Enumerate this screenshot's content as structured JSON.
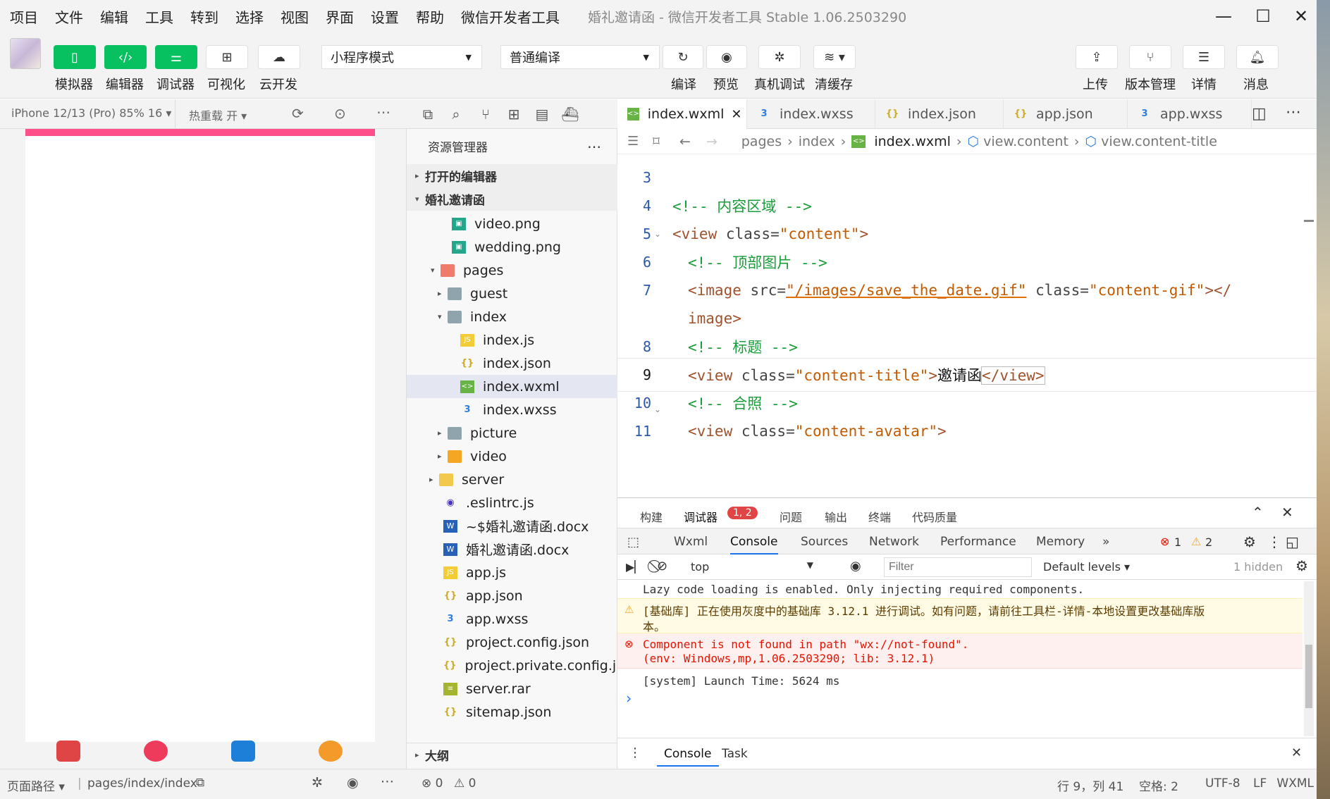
{
  "menu": [
    "项目",
    "文件",
    "编辑",
    "工具",
    "转到",
    "选择",
    "视图",
    "界面",
    "设置",
    "帮助",
    "微信开发者工具"
  ],
  "window_title": "婚礼邀请函 - 微信开发者工具 Stable 1.06.2503290",
  "toolbar": {
    "simulator": "模拟器",
    "editor": "编辑器",
    "debugger": "调试器",
    "visual": "可视化",
    "cloud": "云开发",
    "mode": "小程序模式",
    "compile_mode": "普通编译",
    "compile": "编译",
    "preview": "预览",
    "real_debug": "真机调试",
    "clear_cache": "清缓存",
    "upload": "上传",
    "version": "版本管理",
    "details": "详情",
    "message": "消息"
  },
  "sim": {
    "device": "iPhone 12/13 (Pro) 85% 16 ▾",
    "hot_reload": "热重载 开 ▾"
  },
  "explorer": {
    "title": "资源管理器",
    "open_editors": "打开的编辑器",
    "project": "婚礼邀请函",
    "outline": "大纲",
    "files": [
      {
        "name": "video.png"
      },
      {
        "name": "wedding.png"
      },
      {
        "name": "pages"
      },
      {
        "name": "guest"
      },
      {
        "name": "index"
      },
      {
        "name": "index.js"
      },
      {
        "name": "index.json"
      },
      {
        "name": "index.wxml"
      },
      {
        "name": "index.wxss"
      },
      {
        "name": "picture"
      },
      {
        "name": "video"
      },
      {
        "name": "server"
      },
      {
        "name": ".eslintrc.js"
      },
      {
        "name": "~$婚礼邀请函.docx"
      },
      {
        "name": "婚礼邀请函.docx"
      },
      {
        "name": "app.js"
      },
      {
        "name": "app.json"
      },
      {
        "name": "app.wxss"
      },
      {
        "name": "project.config.json"
      },
      {
        "name": "project.private.config.j..."
      },
      {
        "name": "server.rar"
      },
      {
        "name": "sitemap.json"
      }
    ]
  },
  "tabs": [
    "index.wxml",
    "index.wxss",
    "index.json",
    "app.json",
    "app.wxss"
  ],
  "breadcrumb": [
    "pages",
    "index",
    "index.wxml",
    "view.content",
    "view.content-title"
  ],
  "code": {
    "l3": "3",
    "l4": "4",
    "l5": "5",
    "l6": "6",
    "l7": "7",
    "l8": "8",
    "l9": "9",
    "l10": "10",
    "l11": "11",
    "c4": "<!-- 内容区域 -->",
    "c6": "<!-- 顶部图片 -->",
    "c8": "<!-- 标题 -->",
    "c10": "<!-- 合照 -->",
    "tag_view_open": "<view",
    "tag_image_open": "<image",
    "attr_class": " class=",
    "attr_src": " src=",
    "s_content": "\"content\"",
    "s_gif": "\"/images/save_the_date.gif\"",
    "s_content_gif": "\"content-gif\"",
    "s_content_title": "\"content-title\"",
    "s_content_avatar": "\"content-avatar\"",
    "gt": ">",
    "image_close1": "></",
    "image_close2": "image>",
    "title_text": "邀请函",
    "view_close": "</view>"
  },
  "debug": {
    "tabs": [
      "构建",
      "调试器",
      "问题",
      "输出",
      "终端",
      "代码质量"
    ],
    "badge": "1, 2",
    "devtools": [
      "Wxml",
      "Console",
      "Sources",
      "Network",
      "Performance",
      "Memory",
      "»"
    ],
    "err_count": "1",
    "warn_count": "2",
    "context": "top",
    "filter_placeholder": "Filter",
    "levels": "Default levels ▾",
    "hidden": "1 hidden",
    "log1": "Lazy code loading is enabled. Only injecting required components.",
    "warn1a": "[基础库] 正在使用灰度中的基础库 3.12.1 进行调试。如有问题，请前往工具栏-详情-本地设置更改基础库版",
    "warn1b": "本。",
    "err1a": "Component is not found in path \"wx://not-found\".",
    "err1b": "(env: Windows,mp,1.06.2503290; lib: 3.12.1)",
    "log2": "[system] Launch Time: 5624 ms",
    "prompt": "›",
    "drawer_console": "Console",
    "drawer_task": "Task"
  },
  "status": {
    "page_path_label": "页面路径 ▾",
    "page_path": "pages/index/index",
    "errors": "⊗ 0",
    "warnings": "⚠ 0",
    "cursor": "行 9，列 41",
    "spaces": "空格: 2",
    "encoding": "UTF-8",
    "eol": "LF",
    "lang": "WXML"
  },
  "colors": {
    "accent_green": "#07c160",
    "phone_bar": "#ff4f8b",
    "error": "#e51400",
    "warning": "#f5a623"
  }
}
